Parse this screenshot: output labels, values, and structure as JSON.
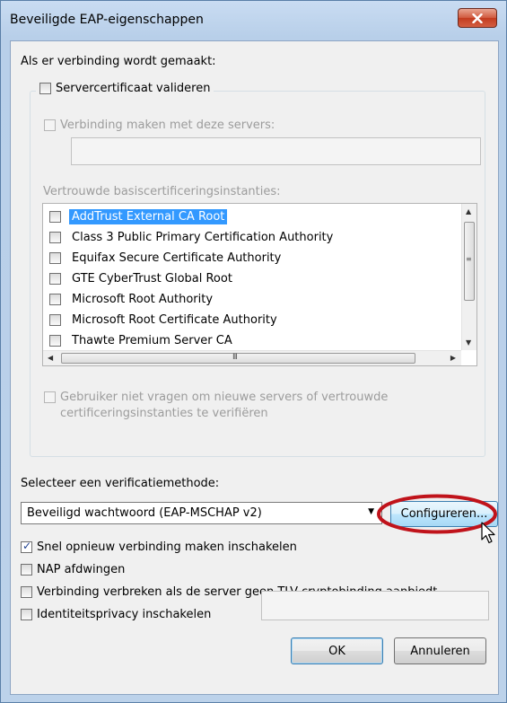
{
  "window": {
    "title": "Beveiligde EAP-eigenschappen"
  },
  "connect_section": {
    "heading": "Als er verbinding wordt gemaakt:",
    "validate_cert": {
      "label": "Servercertificaat valideren",
      "checked": false
    },
    "connect_servers": {
      "label": "Verbinding maken met deze servers:",
      "checked": false,
      "value": ""
    },
    "trusted_root_label": "Vertrouwde basiscertificeringsinstanties:",
    "ca_list": [
      {
        "label": "AddTrust External CA Root",
        "checked": false,
        "selected": true
      },
      {
        "label": "Class 3 Public Primary Certification Authority",
        "checked": false,
        "selected": false
      },
      {
        "label": "Equifax Secure Certificate Authority",
        "checked": false,
        "selected": false
      },
      {
        "label": "GTE CyberTrust Global Root",
        "checked": false,
        "selected": false
      },
      {
        "label": "Microsoft Root Authority",
        "checked": false,
        "selected": false
      },
      {
        "label": "Microsoft Root Certificate Authority",
        "checked": false,
        "selected": false
      },
      {
        "label": "Thawte Premium Server CA",
        "checked": false,
        "selected": false
      }
    ],
    "hscroll_grip": "III",
    "no_prompt": {
      "line1": "Gebruiker niet vragen om nieuwe servers of vertrouwde",
      "line2": "certificeringsinstanties te verifiëren",
      "checked": false
    }
  },
  "auth": {
    "heading": "Selecteer een verificatiemethode:",
    "method_selected": "Beveiligd wachtwoord (EAP-MSCHAP v2)",
    "configure_label": "Configureren..."
  },
  "options": [
    {
      "label": "Snel opnieuw verbinding maken inschakelen",
      "checked": true
    },
    {
      "label": "NAP afdwingen",
      "checked": false
    },
    {
      "label": "Verbinding verbreken als de server geen TLV-cryptobinding aanbiedt",
      "checked": false
    },
    {
      "label": "Identiteitsprivacy inschakelen",
      "checked": false
    }
  ],
  "identity_value": "",
  "buttons": {
    "ok": "OK",
    "cancel": "Annuleren"
  },
  "colors": {
    "selection": "#3399ff",
    "highlight_ring": "#c0131b",
    "close_button": "#c33c1f"
  }
}
